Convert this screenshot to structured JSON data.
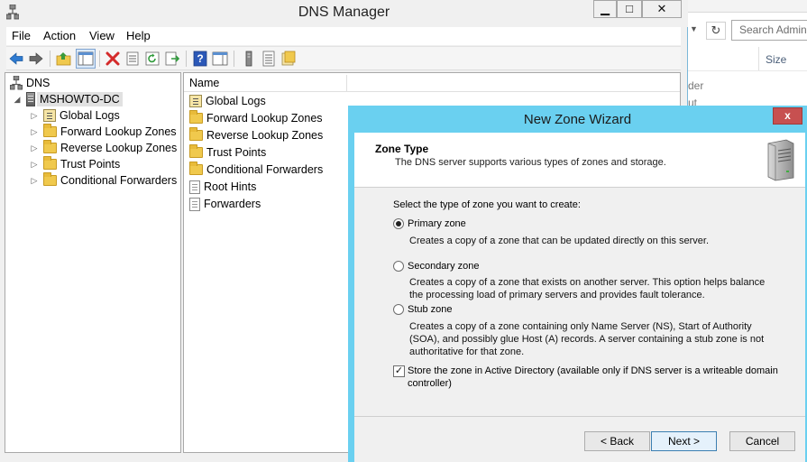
{
  "background_window": {
    "search_placeholder": "Search Admin",
    "column_size": "Size",
    "peek_text_1": "der",
    "peek_text_2": "ut"
  },
  "dns_manager": {
    "title": "DNS Manager",
    "window_buttons": {
      "minimize": "▁",
      "maximize": "□",
      "close": "✕"
    },
    "menu": [
      "File",
      "Action",
      "View",
      "Help"
    ],
    "tree": {
      "root": "DNS",
      "server": "MSHOWTO-DC",
      "children": [
        "Global Logs",
        "Forward Lookup Zones",
        "Reverse Lookup Zones",
        "Trust Points",
        "Conditional Forwarders"
      ]
    },
    "list": {
      "column_name": "Name",
      "items": [
        "Global Logs",
        "Forward Lookup Zones",
        "Reverse Lookup Zones",
        "Trust Points",
        "Conditional Forwarders",
        "Root Hints",
        "Forwarders"
      ]
    }
  },
  "wizard": {
    "title": "New Zone Wizard",
    "close_label": "x",
    "header_title": "Zone Type",
    "header_subtitle": "The DNS server supports various types of zones and storage.",
    "prompt": "Select the type of zone you want to create:",
    "options": [
      {
        "label": "Primary zone",
        "selected": true,
        "description": "Creates a copy of a zone that can be updated directly on this server."
      },
      {
        "label": "Secondary zone",
        "selected": false,
        "description": "Creates a copy of a zone that exists on another server. This option helps balance the processing load of primary servers and provides fault tolerance."
      },
      {
        "label": "Stub zone",
        "selected": false,
        "description": "Creates a copy of a zone containing only Name Server (NS), Start of Authority (SOA), and possibly glue Host (A) records. A server containing a stub zone is not authoritative for that zone."
      }
    ],
    "store_in_ad": {
      "checked": true,
      "label": "Store the zone in Active Directory (available only if DNS server is a writeable domain controller)"
    },
    "buttons": {
      "back": "< Back",
      "next": "Next >",
      "cancel": "Cancel"
    }
  },
  "colors": {
    "wizard_border": "#6ad0f0",
    "close_red": "#c75050",
    "folder_yellow": "#f0c94d",
    "toolbar_blue": "#2f7bd1"
  }
}
